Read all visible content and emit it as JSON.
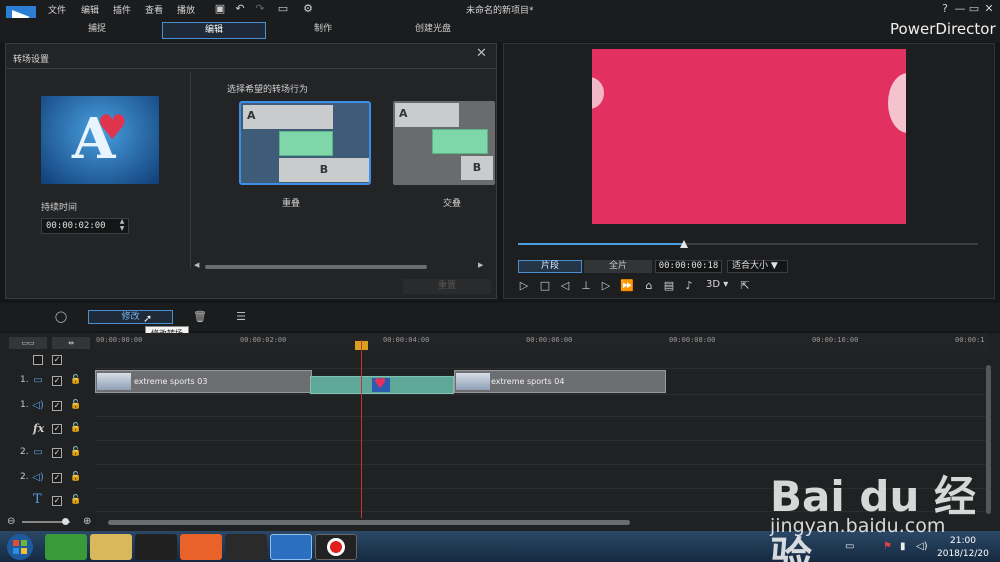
{
  "menu": [
    "文件",
    "编辑",
    "插件",
    "查看",
    "播放"
  ],
  "project_title": "未命名的新项目*",
  "window_controls": [
    "?",
    "—",
    "▭",
    "✕"
  ],
  "mode_tabs": [
    "捕捉",
    "编辑",
    "制作",
    "创建光盘"
  ],
  "brand": "PowerDirector",
  "transition_panel": {
    "title": "转场设置",
    "duration_label": "持续时间",
    "duration_value": "00:00:02:00",
    "behavior_prompt": "选择希望的转场行为",
    "behaviors": [
      {
        "label": "重叠",
        "selected": true
      },
      {
        "label": "交叠",
        "selected": false
      }
    ],
    "block_a": "A",
    "block_b": "B",
    "reset_label": "重置"
  },
  "preview": {
    "seek_position": 0.36,
    "clip_tab": "片段",
    "full_tab": "全片",
    "timecode": "00:00:00:18",
    "fit_select": "适合大小",
    "threed_label": "3D"
  },
  "edit_toolbar": {
    "modify_label": "修改",
    "tooltip": "修改转场"
  },
  "timeline": {
    "ticks": [
      "00:00:00:00",
      "00:00:02:00",
      "00:00:04:00",
      "00:00:06:00",
      "00:00:08:00",
      "00:00:10:00",
      "00:00:1"
    ],
    "tracks": [
      {
        "num": "1.",
        "icon": "video-icon"
      },
      {
        "num": "1.",
        "icon": "audio-icon"
      },
      {
        "num": "",
        "icon": "fx-icon",
        "label": "fx"
      },
      {
        "num": "2.",
        "icon": "video-icon"
      },
      {
        "num": "2.",
        "icon": "audio-icon"
      },
      {
        "num": "",
        "icon": "title-icon",
        "label": "T"
      }
    ],
    "clips": [
      "extreme sports 03",
      "extreme sports 04"
    ]
  },
  "taskbar": {
    "time": "21:00",
    "date": "2018/12/20"
  },
  "watermark": {
    "brand": "Bai du 经验",
    "url": "jingyan.baidu.com"
  },
  "colors": {
    "accent": "#4a8fd0",
    "video_pink": "#e23060",
    "transition_green": "#7fd6a8"
  }
}
